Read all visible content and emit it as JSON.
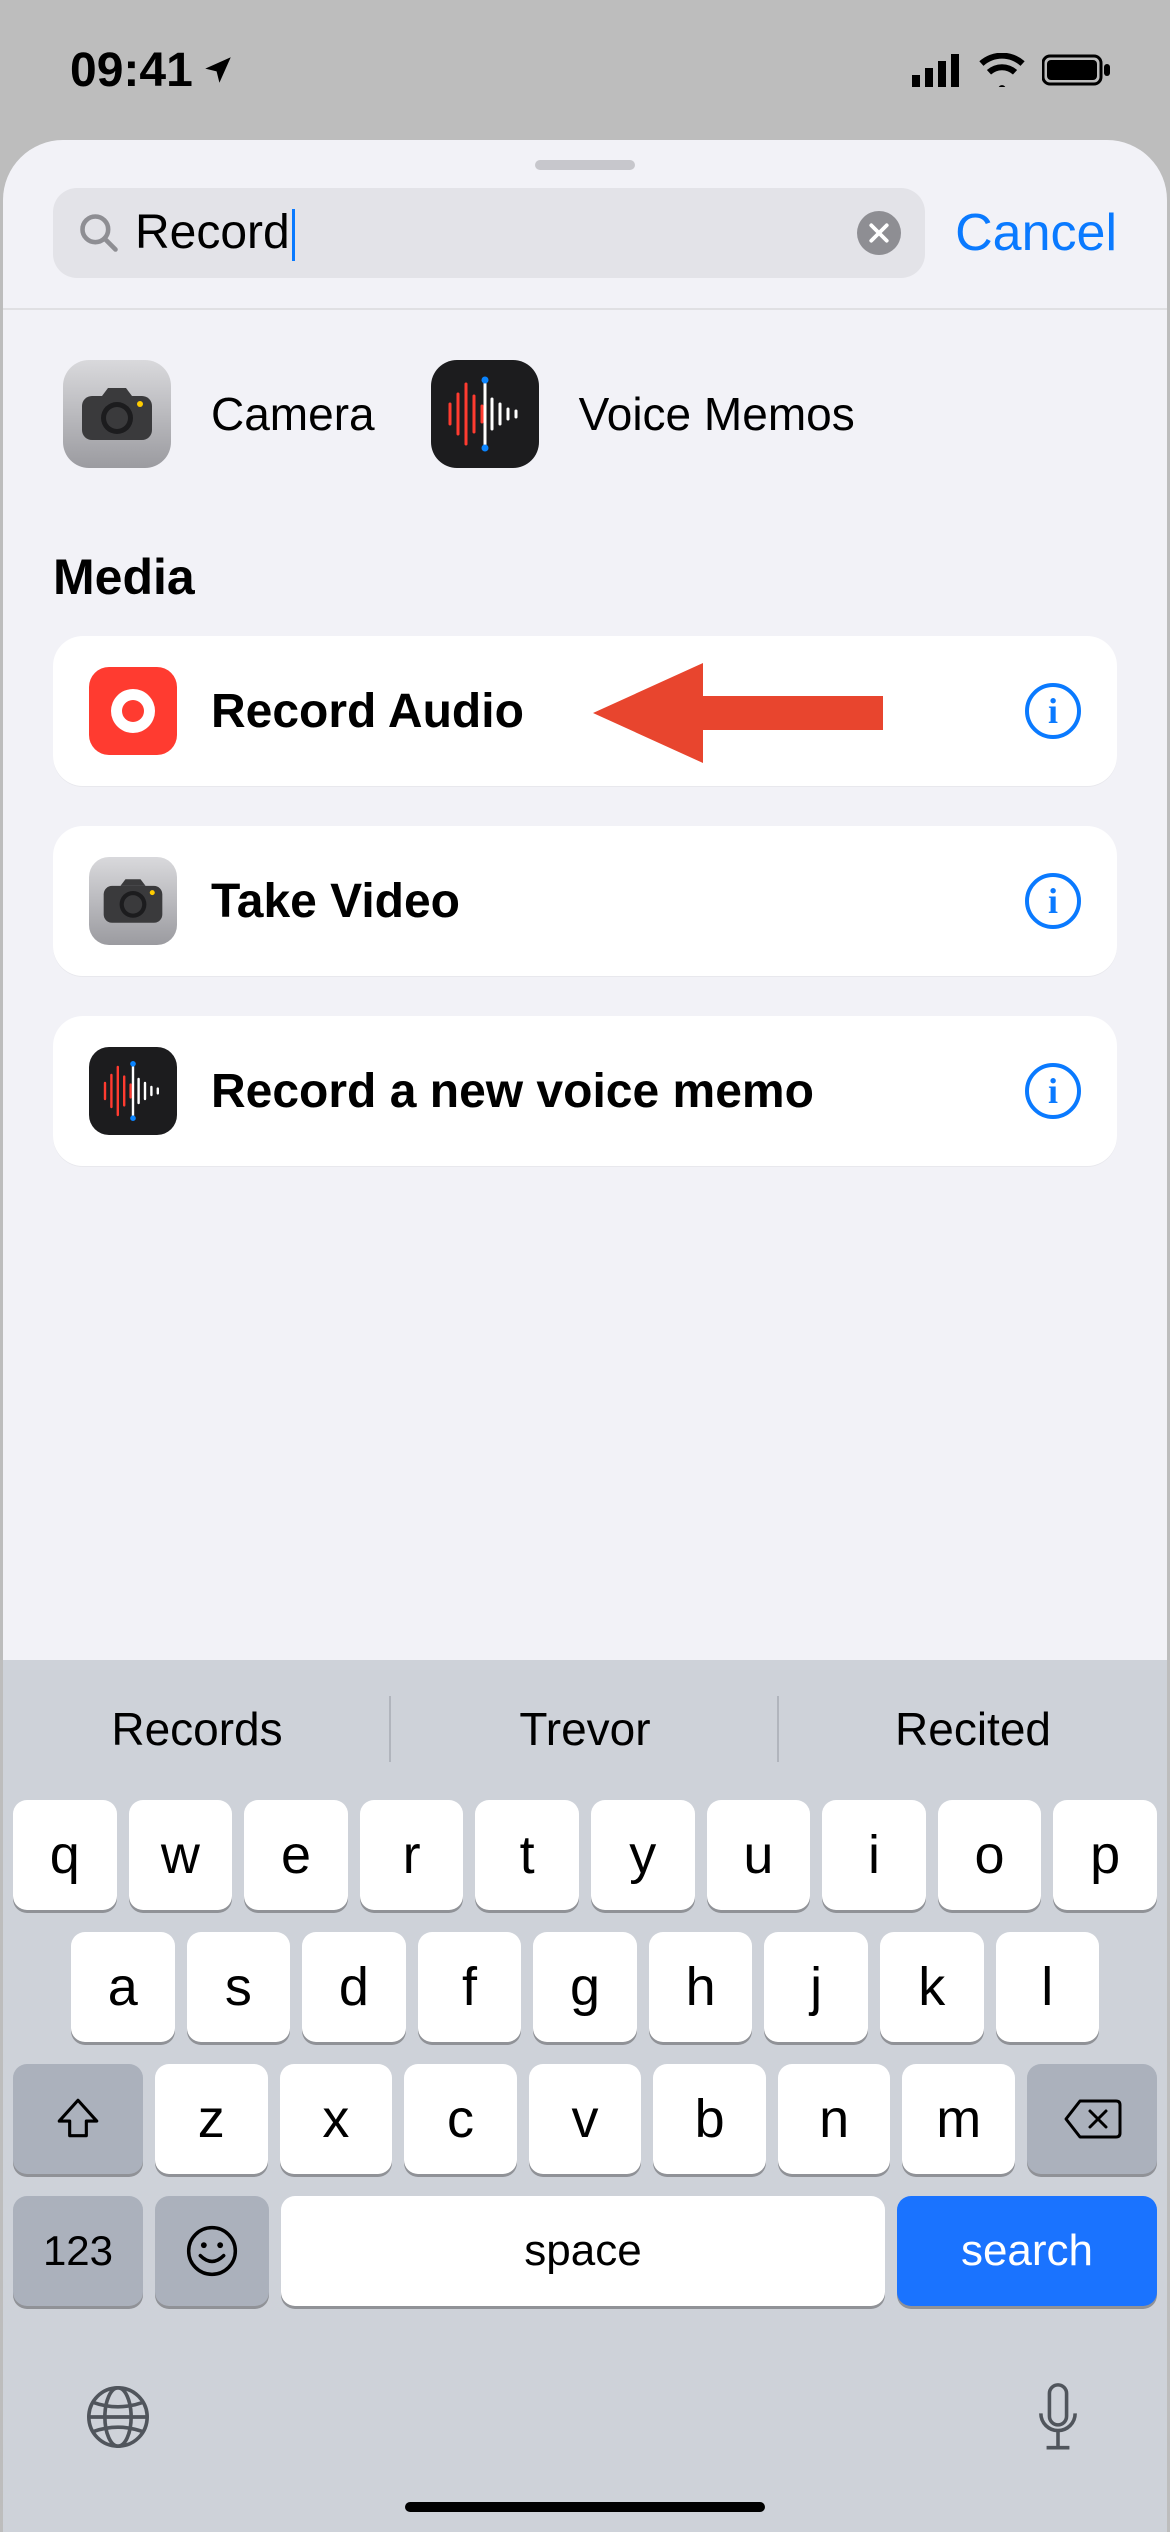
{
  "status": {
    "time": "09:41"
  },
  "search": {
    "value": "Record",
    "cancel": "Cancel"
  },
  "apps": [
    {
      "label": "Camera",
      "icon": "camera-icon"
    },
    {
      "label": "Voice Memos",
      "icon": "voicememo-icon"
    }
  ],
  "section": "Media",
  "actions": [
    {
      "label": "Record Audio",
      "icon": "record-audio-icon",
      "arrow": true
    },
    {
      "label": "Take Video",
      "icon": "camera-icon-small"
    },
    {
      "label": "Record a new voice memo",
      "icon": "voicememo-icon-small"
    }
  ],
  "keyboard": {
    "suggestions": [
      "Records",
      "Trevor",
      "Recited"
    ],
    "row1": [
      "q",
      "w",
      "e",
      "r",
      "t",
      "y",
      "u",
      "i",
      "o",
      "p"
    ],
    "row2": [
      "a",
      "s",
      "d",
      "f",
      "g",
      "h",
      "j",
      "k",
      "l"
    ],
    "row3": [
      "z",
      "x",
      "c",
      "v",
      "b",
      "n",
      "m"
    ],
    "numkey": "123",
    "space": "space",
    "action": "search"
  }
}
